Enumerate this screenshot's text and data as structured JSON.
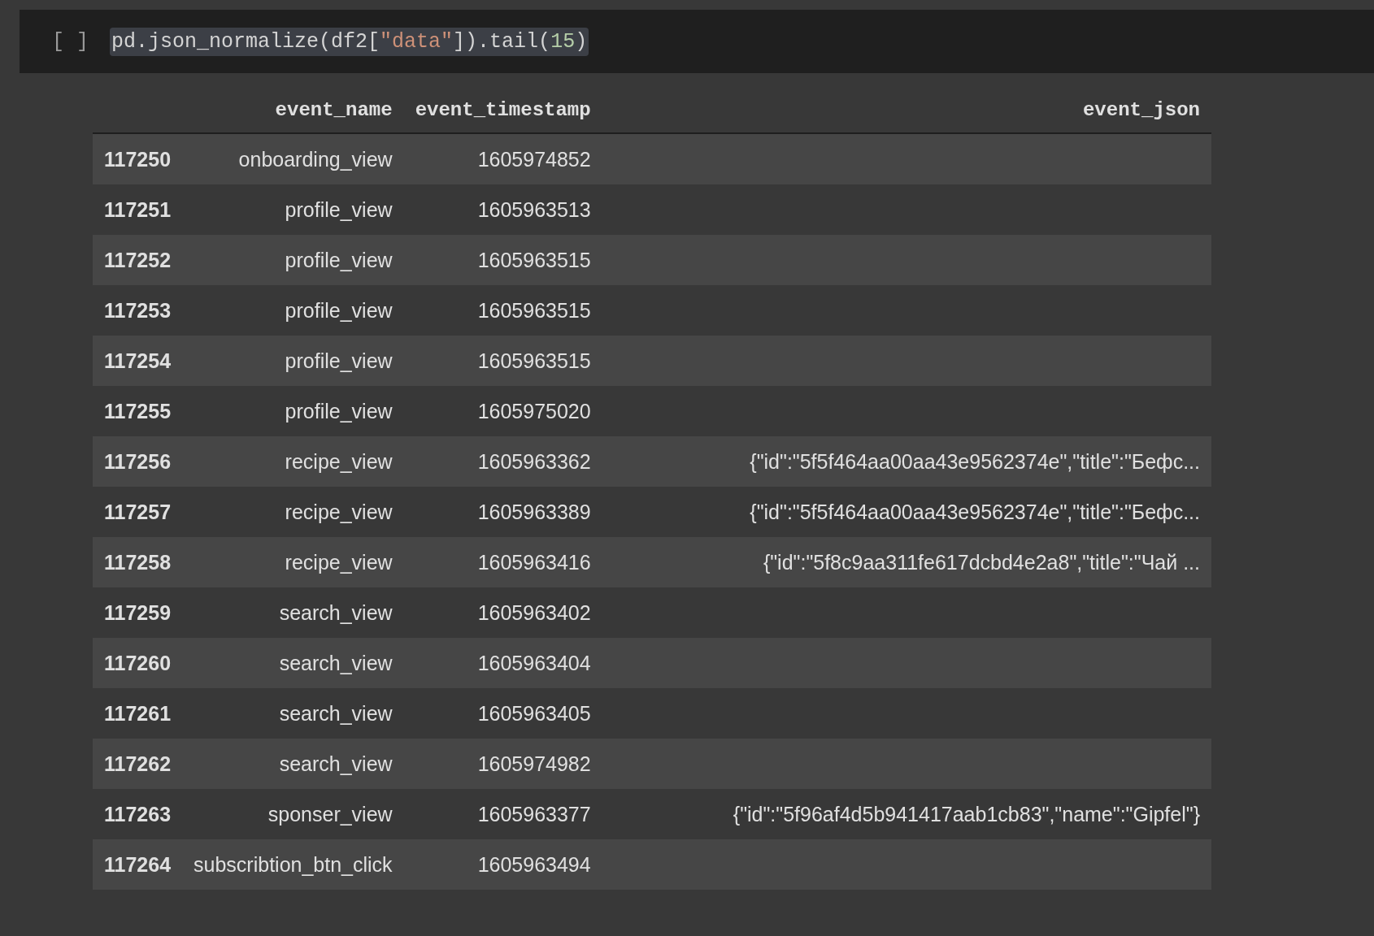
{
  "cell": {
    "prompt": "[ ]",
    "code": [
      {
        "kind": "plain",
        "text": "pd.json_normalize(df2["
      },
      {
        "kind": "string",
        "text": "\"data\""
      },
      {
        "kind": "plain",
        "text": "]).tail("
      },
      {
        "kind": "number",
        "text": "15"
      },
      {
        "kind": "plain",
        "text": ")"
      }
    ],
    "selected": true
  },
  "table": {
    "columns": [
      "event_name",
      "event_timestamp",
      "event_json"
    ],
    "rows": [
      {
        "index": "117250",
        "event_name": "onboarding_view",
        "event_timestamp": "1605974852"
      },
      {
        "index": "117251",
        "event_name": "profile_view",
        "event_timestamp": "1605963513"
      },
      {
        "index": "117252",
        "event_name": "profile_view",
        "event_timestamp": "1605963515"
      },
      {
        "index": "117253",
        "event_name": "profile_view",
        "event_timestamp": "1605963515"
      },
      {
        "index": "117254",
        "event_name": "profile_view",
        "event_timestamp": "1605963515"
      },
      {
        "index": "117255",
        "event_name": "profile_view",
        "event_timestamp": "1605975020"
      },
      {
        "index": "117256",
        "event_name": "recipe_view",
        "event_timestamp": "1605963362",
        "event_json": "{\"id\":\"5f5f464aa00aa43e9562374e\",\"title\":\"Бефс..."
      },
      {
        "index": "117257",
        "event_name": "recipe_view",
        "event_timestamp": "1605963389",
        "event_json": "{\"id\":\"5f5f464aa00aa43e9562374e\",\"title\":\"Бефс..."
      },
      {
        "index": "117258",
        "event_name": "recipe_view",
        "event_timestamp": "1605963416",
        "event_json": "{\"id\":\"5f8c9aa311fe617dcbd4e2a8\",\"title\":\"Чай ..."
      },
      {
        "index": "117259",
        "event_name": "search_view",
        "event_timestamp": "1605963402"
      },
      {
        "index": "117260",
        "event_name": "search_view",
        "event_timestamp": "1605963404"
      },
      {
        "index": "117261",
        "event_name": "search_view",
        "event_timestamp": "1605963405"
      },
      {
        "index": "117262",
        "event_name": "search_view",
        "event_timestamp": "1605974982"
      },
      {
        "index": "117263",
        "event_name": "sponser_view",
        "event_timestamp": "1605963377",
        "event_json": "{\"id\":\"5f96af4d5b941417aab1cb83\",\"name\":\"Gipfel\"}"
      },
      {
        "index": "117264",
        "event_name": "subscribtion_btn_click",
        "event_timestamp": "1605963494"
      }
    ]
  }
}
